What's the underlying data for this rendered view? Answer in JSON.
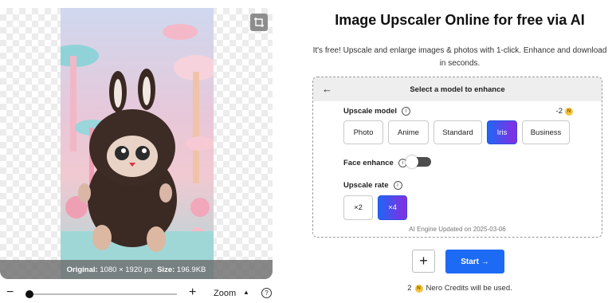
{
  "preview": {
    "info_original_label": "Original:",
    "info_original_value": "1080 × 1920 px",
    "info_size_label": "Size:",
    "info_size_value": "196.9KB"
  },
  "zoom": {
    "minus": "−",
    "plus": "+",
    "label": "Zoom",
    "caret": "▲",
    "help": "?",
    "slider_level": 0.0
  },
  "header": {
    "title": "Image Upscaler Online for free via AI",
    "subtitle": "It's free! Upscale and enlarge images & photos with 1-click. Enhance and download in seconds."
  },
  "panel": {
    "heading": "Select a model to enhance",
    "back_arrow": "←",
    "upscale_model_label": "Upscale model",
    "credit_cost": "-2",
    "models": [
      {
        "label": "Photo",
        "active": false
      },
      {
        "label": "Anime",
        "active": false
      },
      {
        "label": "Standard",
        "active": false
      },
      {
        "label": "Iris",
        "active": true
      },
      {
        "label": "Business",
        "active": false
      }
    ],
    "face_enhance_label": "Face enhance",
    "face_enhance_on": false,
    "upscale_rate_label": "Upscale rate",
    "rates": [
      {
        "label": "×2",
        "active": false
      },
      {
        "label": "×4",
        "active": true
      }
    ],
    "engine_note": "AI Engine Updated on 2025-03-06",
    "info_glyph": "i",
    "coin_glyph": "N"
  },
  "actions": {
    "plus": "+",
    "start": "Start →",
    "credits_count": "2",
    "credits_text": "Nero Credits will be used."
  },
  "colors": {
    "accent_blue": "#1d6af5",
    "accent_purple": "#8a2be2",
    "coin": "#f3c33b"
  }
}
